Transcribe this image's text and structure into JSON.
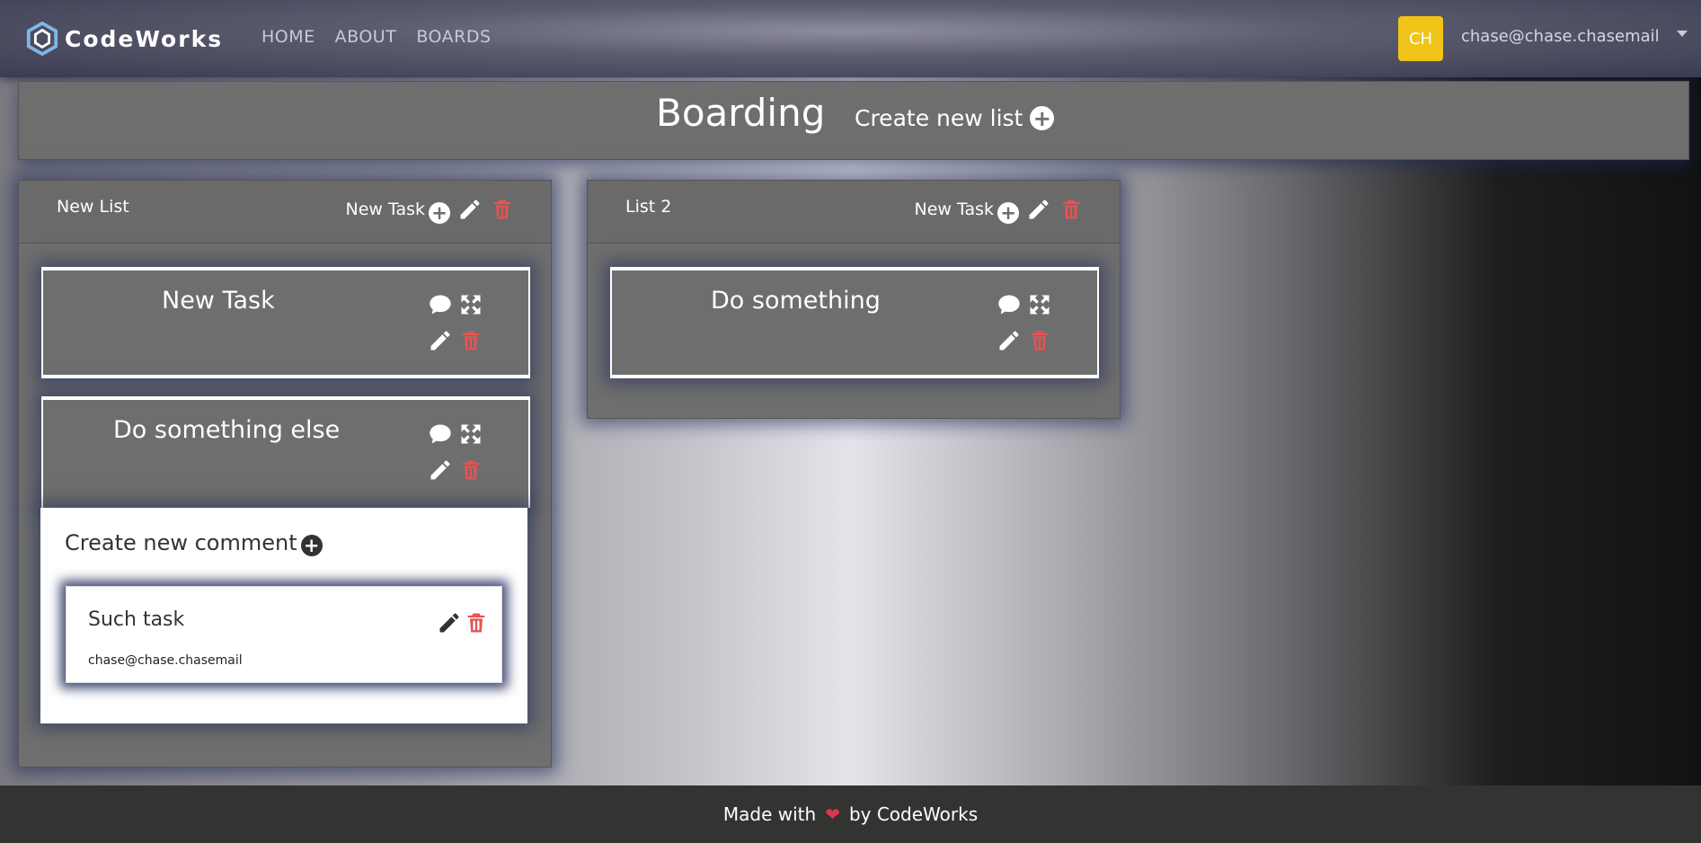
{
  "navbar": {
    "brand": "CodeWorks",
    "links": [
      "HOME",
      "ABOUT",
      "BOARDS"
    ],
    "avatar_initials": "CH",
    "user_email": "chase@chase.chasemail"
  },
  "board": {
    "title": "Boarding",
    "create_list_label": "Create new list"
  },
  "lists": [
    {
      "title": "New List",
      "new_task_label": "New Task",
      "tasks": [
        {
          "title": "New Task"
        },
        {
          "title": "Do something else"
        }
      ],
      "comments_panel": {
        "create_label": "Create new comment",
        "comments": [
          {
            "text": "Such task",
            "author": "chase@chase.chasemail"
          }
        ]
      }
    },
    {
      "title": "List 2",
      "new_task_label": "New Task",
      "tasks": [
        {
          "title": "Do something"
        }
      ]
    }
  ],
  "footer": {
    "prefix": "Made with",
    "suffix": "by CodeWorks",
    "heart_icon": "heart-icon"
  },
  "colors": {
    "delete": "#e55353",
    "avatar": "#f0c419"
  }
}
